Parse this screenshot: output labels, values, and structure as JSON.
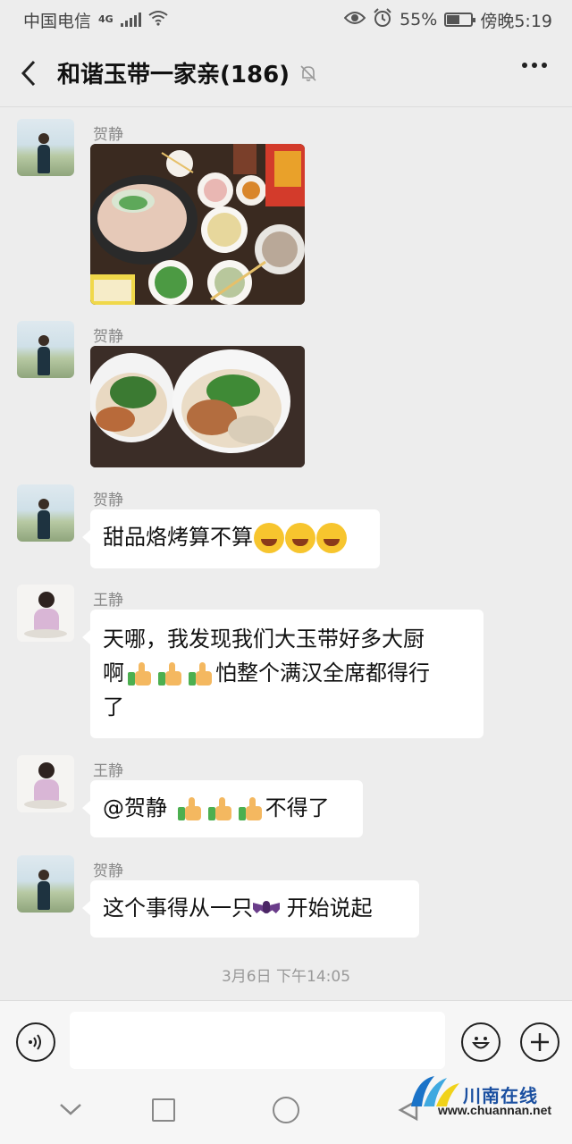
{
  "status_bar": {
    "carrier": "中国电信",
    "network": "4G",
    "battery": "55%",
    "battery_level": 0.55,
    "time": "傍晚5:19"
  },
  "header": {
    "title": "和谐玉带一家亲(186)"
  },
  "messages": [
    {
      "sender": "贺静",
      "type": "image"
    },
    {
      "sender": "贺静",
      "type": "image"
    },
    {
      "sender": "贺静",
      "type": "text",
      "text": "甜品烙烤算不算"
    },
    {
      "sender": "王静",
      "type": "text",
      "text_line1_a": "天哪，我发现我们大玉带好多大厨",
      "text_line2_a": "啊",
      "text_line2_b": "怕整个满汉全席都得行",
      "text_line3": "了"
    },
    {
      "sender": "王静",
      "type": "text",
      "text_a": "@贺静 ",
      "text_b": "不得了"
    },
    {
      "sender": "贺静",
      "type": "text",
      "text_a": "这个事得从一只",
      "text_b": " 开始说起"
    }
  ],
  "timestamp": "3月6日 下午14:05",
  "input": {
    "placeholder": ""
  },
  "watermark": {
    "cn": "川南在线",
    "en": "www.chuannan.net"
  },
  "colors": {
    "background": "#ededed",
    "bubble": "#ffffff",
    "name": "#888888"
  }
}
